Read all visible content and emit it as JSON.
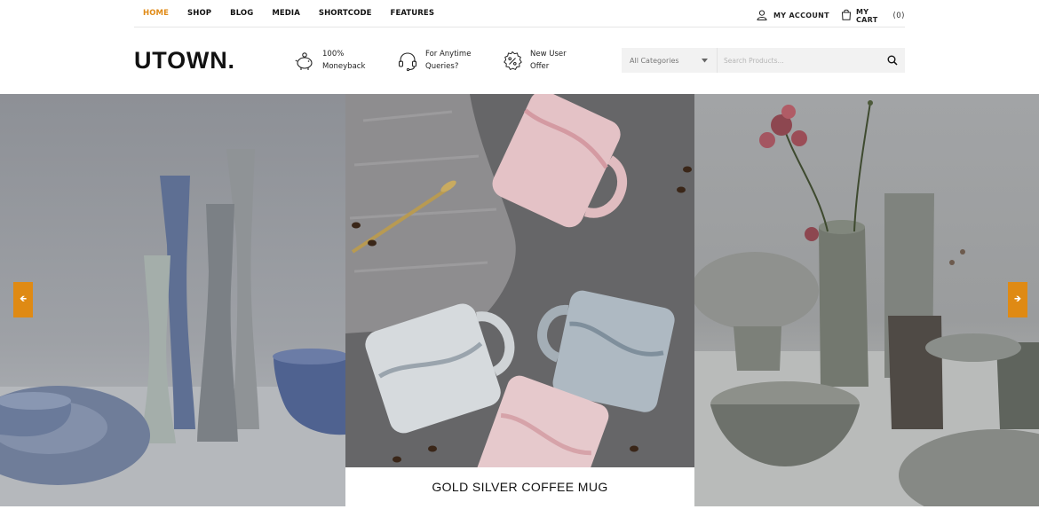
{
  "nav": {
    "items": [
      {
        "label": "HOME",
        "active": true
      },
      {
        "label": "SHOP",
        "active": false
      },
      {
        "label": "BLOG",
        "active": false
      },
      {
        "label": "MEDIA",
        "active": false
      },
      {
        "label": "SHORTCODE",
        "active": false
      },
      {
        "label": "FEATURES",
        "active": false
      }
    ],
    "account_label": "MY ACCOUNT",
    "cart_label": "MY CART",
    "cart_count": "(0)"
  },
  "header": {
    "logo": "UTOWN.",
    "features": [
      {
        "icon": "piggy-bank-icon",
        "line1": "100%",
        "line2": "Moneyback"
      },
      {
        "icon": "headset-icon",
        "line1": "For Anytime",
        "line2": "Queries?"
      },
      {
        "icon": "discount-badge-icon",
        "line1": "New User",
        "line2": "Offer"
      }
    ],
    "search": {
      "category_value": "All Categories",
      "placeholder": "Search Products..."
    }
  },
  "hero": {
    "caption": "GOLD SILVER COFFEE MUG",
    "prev_icon": "arrow-left-icon",
    "next_icon": "arrow-right-icon"
  },
  "colors": {
    "accent": "#df8a14",
    "active_nav": "#e08a16",
    "text": "#111111",
    "search_bg": "#f2f2f2"
  }
}
